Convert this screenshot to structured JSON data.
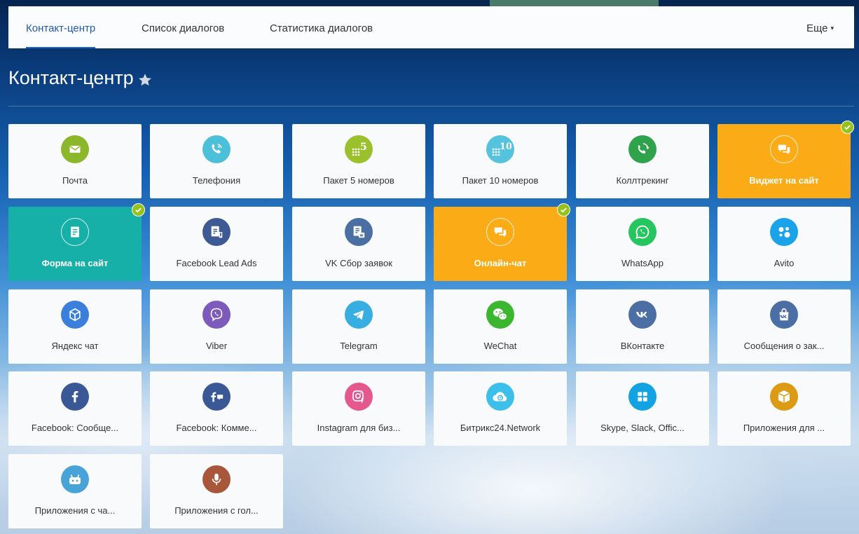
{
  "nav": {
    "tabs": [
      {
        "label": "Контакт-центр",
        "active": true
      },
      {
        "label": "Список диалогов",
        "active": false
      },
      {
        "label": "Статистика диалогов",
        "active": false
      }
    ],
    "more_label": "Еще"
  },
  "page": {
    "title": "Контакт-центр"
  },
  "colors": {
    "accent": "#2066c4",
    "connected_orange": "#fbab16",
    "connected_teal": "#17b0a8",
    "check_green": "#97c11b"
  },
  "tiles": [
    {
      "label": "Почта",
      "icon": "mail-icon",
      "color": "#8cb72b",
      "connected": false
    },
    {
      "label": "Телефония",
      "icon": "phone-icon",
      "color": "#4dc0d9",
      "connected": false
    },
    {
      "label": "Пакет 5 номеров",
      "icon": "package-5-icon",
      "color": "#9ac12c",
      "connected": false,
      "badge": "5"
    },
    {
      "label": "Пакет 10 номеров",
      "icon": "package-10-icon",
      "color": "#55c3dd",
      "connected": false,
      "badge": "10"
    },
    {
      "label": "Коллтрекинг",
      "icon": "calltracking-icon",
      "color": "#2fa34c",
      "connected": false
    },
    {
      "label": "Виджет на сайт",
      "icon": "chat-widget-icon",
      "color": "#fbab16",
      "connected": true
    },
    {
      "label": "Форма на сайт",
      "icon": "form-icon",
      "color": "#17b0a8",
      "connected": true
    },
    {
      "label": "Facebook Lead Ads",
      "icon": "facebook-lead-ads-icon",
      "color": "#3e5a95",
      "connected": false
    },
    {
      "label": "VK Сбор заявок",
      "icon": "vk-leads-icon",
      "color": "#4a6fa3",
      "connected": false
    },
    {
      "label": "Онлайн-чат",
      "icon": "online-chat-icon",
      "color": "#fbab16",
      "connected": true
    },
    {
      "label": "WhatsApp",
      "icon": "whatsapp-icon",
      "color": "#25c65f",
      "connected": false
    },
    {
      "label": "Avito",
      "icon": "avito-icon",
      "color": "#1aa3e8",
      "connected": false
    },
    {
      "label": "Яндекс чат",
      "icon": "yandex-chat-icon",
      "color": "#3a7fdb",
      "connected": false
    },
    {
      "label": "Viber",
      "icon": "viber-icon",
      "color": "#7d5bbd",
      "connected": false
    },
    {
      "label": "Telegram",
      "icon": "telegram-icon",
      "color": "#37aee2",
      "connected": false
    },
    {
      "label": "WeChat",
      "icon": "wechat-icon",
      "color": "#3ab72f",
      "connected": false
    },
    {
      "label": "ВКонтакте",
      "icon": "vk-icon",
      "color": "#4b6fa5",
      "connected": false
    },
    {
      "label": "Сообщения о зак...",
      "icon": "vk-orders-icon",
      "color": "#4b6fa5",
      "connected": false
    },
    {
      "label": "Facebook: Сообще...",
      "icon": "facebook-icon",
      "color": "#3b5896",
      "connected": false
    },
    {
      "label": "Facebook: Комме...",
      "icon": "facebook-comments-icon",
      "color": "#3b5896",
      "connected": false
    },
    {
      "label": "Instagram для биз...",
      "icon": "instagram-icon",
      "color": "#e4588e",
      "connected": false
    },
    {
      "label": "Битрикс24.Network",
      "icon": "bitrix-network-icon",
      "color": "#3cbfe8",
      "connected": false
    },
    {
      "label": "Skype, Slack, Offic...",
      "icon": "apps-grid-icon",
      "color": "#13a2e2",
      "connected": false
    },
    {
      "label": "Приложения для ...",
      "icon": "box-icon",
      "color": "#dd9a14",
      "connected": false
    },
    {
      "label": "Приложения с ча...",
      "icon": "robot-icon",
      "color": "#48a4d8",
      "connected": false
    },
    {
      "label": "Приложения с гол...",
      "icon": "microphone-icon",
      "color": "#a8573a",
      "connected": false
    }
  ]
}
